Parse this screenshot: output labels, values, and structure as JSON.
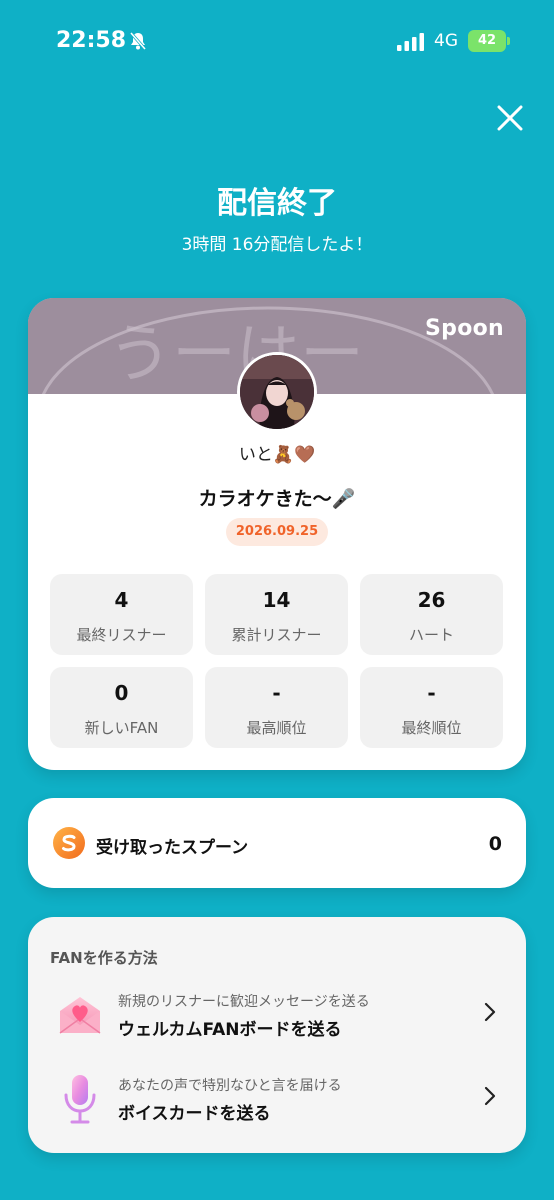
{
  "status_bar": {
    "time": "22:58",
    "network": "4G",
    "battery": "42",
    "icons": [
      "bell-slash-icon",
      "signal-icon",
      "battery-icon"
    ]
  },
  "header": {
    "title": "配信終了",
    "subtitle": "3時間 16分配信したよ！"
  },
  "card": {
    "brand": "Spoon",
    "banner_text": "うーはー",
    "host_name": "いと🧸🤎",
    "live_title": "カラオケきた〜🎤",
    "date": "2026.09.25",
    "stats": [
      {
        "value": "4",
        "label": "最終リスナー"
      },
      {
        "value": "14",
        "label": "累計リスナー"
      },
      {
        "value": "26",
        "label": "ハート"
      },
      {
        "value": "0",
        "label": "新しいFAN"
      },
      {
        "value": "-",
        "label": "最高順位"
      },
      {
        "value": "-",
        "label": "最終順位"
      }
    ]
  },
  "spoons": {
    "label": "受け取ったスプーン",
    "count": "0"
  },
  "fan_section": {
    "heading": "FANを作る方法",
    "options": [
      {
        "description": "新規のリスナーに歓迎メッセージを送る",
        "title": "ウェルカムFANボードを送る",
        "icon": "envelope-heart-icon"
      },
      {
        "description": "あなたの声で特別なひと言を届ける",
        "title": "ボイスカードを送る",
        "icon": "microphone-icon"
      }
    ]
  },
  "colors": {
    "background": "#0fb0c6",
    "accent_orange": "#f0632a",
    "banner": "#9a8b9b"
  }
}
